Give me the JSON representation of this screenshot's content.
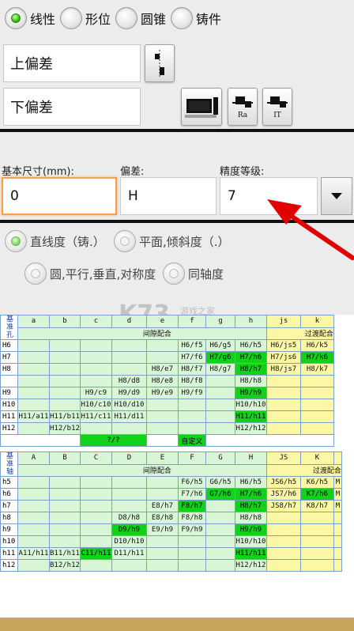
{
  "type_options": [
    {
      "label": "线性",
      "selected": true
    },
    {
      "label": "形位",
      "selected": false
    },
    {
      "label": "圆锥",
      "selected": false
    },
    {
      "label": "铸件",
      "selected": false
    }
  ],
  "upper_dev_label": "上偏差",
  "lower_dev_label": "下偏差",
  "buttons": {
    "ra": "Ra",
    "it": "IT"
  },
  "basic_size_label": "基本尺寸(mm):",
  "deviation_label": "偏差:",
  "grade_label": "精度等级:",
  "basic_size_value": "0",
  "deviation_value": "H",
  "grade_value": "7",
  "form_options": [
    {
      "label": "直线度（铸.）",
      "selected": true
    },
    {
      "label": "平面,倾斜度（.）",
      "selected": false
    },
    {
      "label": "圆,平行,垂直,对称度",
      "selected": false
    },
    {
      "label": "同轴度",
      "selected": false
    }
  ],
  "watermark": "K73",
  "watermark_sub": "游戏之家",
  "hole_table": {
    "corner": [
      "基",
      "准",
      "孔"
    ],
    "cols": [
      "a",
      "b",
      "c",
      "d",
      "e",
      "f",
      "g",
      "h",
      "js",
      "k"
    ],
    "group_gap": "间隙配合",
    "group_trans": "过渡配合",
    "rows": [
      {
        "h": "H6",
        "c": [
          "",
          "",
          "",
          "",
          "",
          "H6/f5",
          "H6/g5",
          "H6/h5",
          "H6/js5",
          "H6/k5"
        ]
      },
      {
        "h": "H7",
        "c": [
          "",
          "",
          "",
          "",
          "",
          "H7/f6",
          "H7/g6",
          "H7/h6",
          "H7/js6",
          "H7/k6"
        ]
      },
      {
        "h": "H8",
        "c": [
          "",
          "",
          "",
          "",
          "H8/e7",
          "H8/f7",
          "H8/g7",
          "H8/h7",
          "H8/js7",
          "H8/k7"
        ]
      },
      {
        "h": "",
        "c": [
          "",
          "",
          "",
          "H8/d8",
          "H8/e8",
          "H8/f8",
          "",
          "H8/h8",
          "",
          ""
        ]
      },
      {
        "h": "H9",
        "c": [
          "",
          "",
          "H9/c9",
          "H9/d9",
          "H9/e9",
          "H9/f9",
          "",
          "H9/h9",
          "",
          ""
        ]
      },
      {
        "h": "H10",
        "c": [
          "",
          "",
          "H10/c10",
          "H10/d10",
          "",
          "",
          "",
          "H10/h10",
          "",
          ""
        ]
      },
      {
        "h": "H11",
        "c": [
          "H11/a11",
          "H11/b11",
          "H11/c11",
          "H11/d11",
          "",
          "",
          "",
          "H11/h11",
          "",
          ""
        ]
      },
      {
        "h": "H12",
        "c": [
          "",
          "H12/b12",
          "",
          "",
          "",
          "",
          "",
          "H12/h12",
          "",
          ""
        ]
      }
    ],
    "footer": [
      "?/?",
      "自定义"
    ]
  },
  "shaft_table": {
    "corner": [
      "基",
      "准",
      "轴"
    ],
    "cols": [
      "A",
      "B",
      "C",
      "D",
      "E",
      "F",
      "G",
      "H",
      "JS",
      "K",
      ""
    ],
    "group_gap": "间隙配合",
    "group_trans": "过渡配合",
    "rows": [
      {
        "h": "h5",
        "c": [
          "",
          "",
          "",
          "",
          "",
          "F6/h5",
          "G6/h5",
          "H6/h5",
          "JS6/h5",
          "K6/h5",
          "M"
        ]
      },
      {
        "h": "h6",
        "c": [
          "",
          "",
          "",
          "",
          "",
          "F7/h6",
          "G7/h6",
          "H7/h6",
          "JS7/h6",
          "K7/h6",
          "M"
        ]
      },
      {
        "h": "h7",
        "c": [
          "",
          "",
          "",
          "",
          "E8/h7",
          "F8/h7",
          "",
          "H8/h7",
          "JS8/h7",
          "K8/h7",
          "M"
        ]
      },
      {
        "h": "h8",
        "c": [
          "",
          "",
          "",
          "D8/h8",
          "E8/h8",
          "F8/h8",
          "",
          "H8/h8",
          "",
          "",
          ""
        ]
      },
      {
        "h": "h9",
        "c": [
          "",
          "",
          "",
          "D9/h9",
          "E9/h9",
          "F9/h9",
          "",
          "H9/h9",
          "",
          "",
          ""
        ]
      },
      {
        "h": "h10",
        "c": [
          "",
          "",
          "",
          "D10/h10",
          "",
          "",
          "",
          "H10/h10",
          "",
          "",
          ""
        ]
      },
      {
        "h": "h11",
        "c": [
          "A11/h11",
          "B11/h11",
          "C11/h11",
          "D11/h11",
          "",
          "",
          "",
          "H11/h11",
          "",
          "",
          ""
        ]
      },
      {
        "h": "h12",
        "c": [
          "",
          "B12/h12",
          "",
          "",
          "",
          "",
          "",
          "H12/h12",
          "",
          "",
          ""
        ]
      }
    ]
  },
  "highlight_color": "#13d11b",
  "gap_color": "#d8f5d6",
  "trans_color": "#fbf7a4"
}
